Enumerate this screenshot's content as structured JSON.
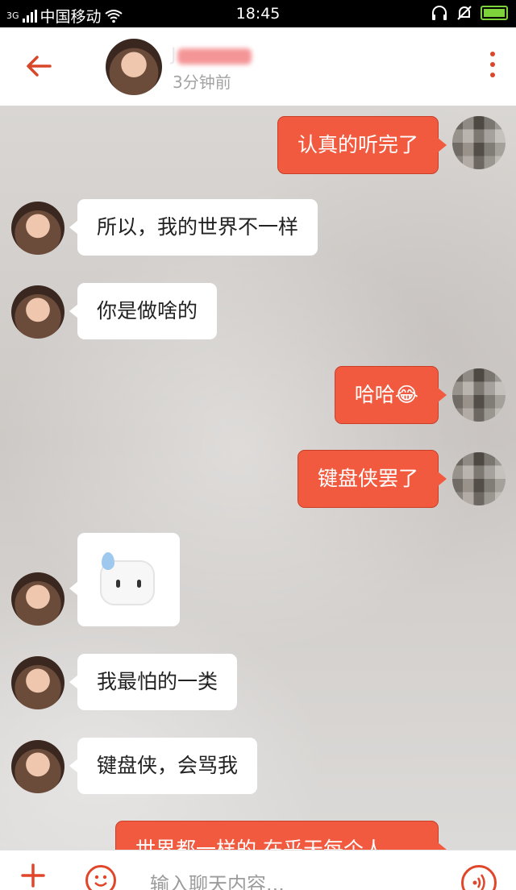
{
  "status_bar": {
    "network": "3G",
    "carrier": "中国移动",
    "time": "18:45"
  },
  "header": {
    "contact_name": "J",
    "last_seen": "3分钟前"
  },
  "messages": [
    {
      "side": "out",
      "text": "认真的听完了"
    },
    {
      "side": "in",
      "text": "所以，我的世界不一样"
    },
    {
      "side": "in",
      "text": "你是做啥的"
    },
    {
      "side": "out",
      "text": "哈哈😂"
    },
    {
      "side": "out",
      "text": "键盘侠罢了"
    },
    {
      "side": "in",
      "type": "sticker",
      "sticker": "sweat-drop-face-icon"
    },
    {
      "side": "in",
      "text": "我最怕的一类"
    },
    {
      "side": "in",
      "text": "键盘侠，会骂我"
    },
    {
      "side": "out",
      "text": "世界都一样的 在乎天每个人"
    }
  ],
  "input": {
    "placeholder": "输入聊天内容..."
  },
  "colors": {
    "accent": "#f15a3f",
    "icon_red": "#d9472b",
    "incoming_bubble": "#ffffff"
  }
}
